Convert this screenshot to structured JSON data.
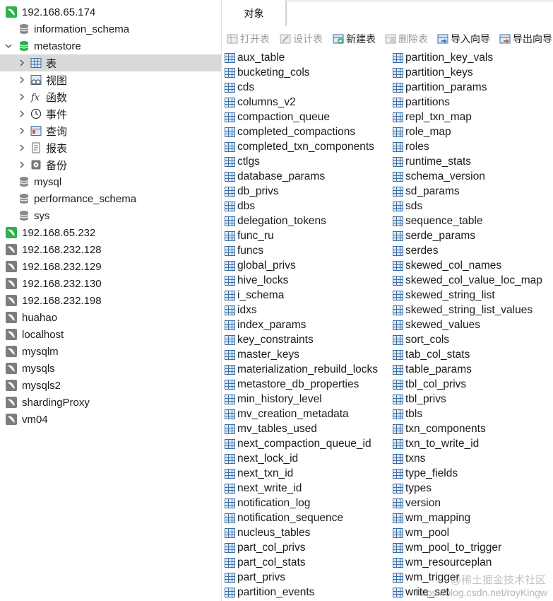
{
  "nav": {
    "items": [
      {
        "label": "192.168.65.174",
        "kind": "connection",
        "state": "open",
        "icon": "connection-green-icon"
      },
      {
        "label": "information_schema",
        "kind": "database",
        "icon": "database-icon"
      },
      {
        "label": "metastore",
        "kind": "database",
        "state": "open",
        "icon": "database-green-icon"
      },
      {
        "label": "表",
        "kind": "group",
        "selected": true,
        "icon": "table-grid-icon"
      },
      {
        "label": "视图",
        "kind": "group",
        "icon": "view-icon"
      },
      {
        "label": "函数",
        "kind": "group",
        "icon": "function-icon"
      },
      {
        "label": "事件",
        "kind": "group",
        "icon": "clock-icon"
      },
      {
        "label": "查询",
        "kind": "group",
        "icon": "query-icon"
      },
      {
        "label": "报表",
        "kind": "group",
        "icon": "report-icon"
      },
      {
        "label": "备份",
        "kind": "group",
        "icon": "backup-icon"
      },
      {
        "label": "mysql",
        "kind": "database",
        "icon": "database-icon"
      },
      {
        "label": "performance_schema",
        "kind": "database",
        "icon": "database-icon"
      },
      {
        "label": "sys",
        "kind": "database",
        "icon": "database-icon"
      },
      {
        "label": "192.168.65.232",
        "kind": "connection",
        "icon": "connection-green-icon"
      },
      {
        "label": "192.168.232.128",
        "kind": "connection",
        "icon": "connection-gray-icon"
      },
      {
        "label": "192.168.232.129",
        "kind": "connection",
        "icon": "connection-gray-icon"
      },
      {
        "label": "192.168.232.130",
        "kind": "connection",
        "icon": "connection-gray-icon"
      },
      {
        "label": "192.168.232.198",
        "kind": "connection",
        "icon": "connection-gray-icon"
      },
      {
        "label": "huahao",
        "kind": "connection",
        "icon": "connection-gray-icon"
      },
      {
        "label": "localhost",
        "kind": "connection",
        "icon": "connection-gray-icon"
      },
      {
        "label": "mysqlm",
        "kind": "connection",
        "icon": "connection-gray-icon"
      },
      {
        "label": "mysqls",
        "kind": "connection",
        "icon": "connection-gray-icon"
      },
      {
        "label": "mysqls2",
        "kind": "connection",
        "icon": "connection-gray-icon"
      },
      {
        "label": "shardingProxy",
        "kind": "connection",
        "icon": "connection-gray-icon"
      },
      {
        "label": "vm04",
        "kind": "connection",
        "icon": "connection-gray-icon"
      }
    ]
  },
  "tabs": {
    "objects_label": "对象"
  },
  "toolbar": {
    "open_table": "打开表",
    "design_table": "设计表",
    "new_table": "新建表",
    "delete_table": "删除表",
    "import_wizard": "导入向导",
    "export_wizard": "导出向导"
  },
  "tables": {
    "col1": [
      "aux_table",
      "bucketing_cols",
      "cds",
      "columns_v2",
      "compaction_queue",
      "completed_compactions",
      "completed_txn_components",
      "ctlgs",
      "database_params",
      "db_privs",
      "dbs",
      "delegation_tokens",
      "func_ru",
      "funcs",
      "global_privs",
      "hive_locks",
      "i_schema",
      "idxs",
      "index_params",
      "key_constraints",
      "master_keys",
      "materialization_rebuild_locks",
      "metastore_db_properties",
      "min_history_level",
      "mv_creation_metadata",
      "mv_tables_used",
      "next_compaction_queue_id",
      "next_lock_id",
      "next_txn_id",
      "next_write_id",
      "notification_log",
      "notification_sequence",
      "nucleus_tables",
      "part_col_privs",
      "part_col_stats",
      "part_privs",
      "partition_events"
    ],
    "col2": [
      "partition_key_vals",
      "partition_keys",
      "partition_params",
      "partitions",
      "repl_txn_map",
      "role_map",
      "roles",
      "runtime_stats",
      "schema_version",
      "sd_params",
      "sds",
      "sequence_table",
      "serde_params",
      "serdes",
      "skewed_col_names",
      "skewed_col_value_loc_map",
      "skewed_string_list",
      "skewed_string_list_values",
      "skewed_values",
      "sort_cols",
      "tab_col_stats",
      "table_params",
      "tbl_col_privs",
      "tbl_privs",
      "tbls",
      "txn_components",
      "txn_to_write_id",
      "txns",
      "type_fields",
      "types",
      "version",
      "wm_mapping",
      "wm_pool",
      "wm_pool_to_trigger",
      "wm_resourceplan",
      "wm_trigger",
      "write_set"
    ]
  },
  "watermark": {
    "line1": "@稀土掘金技术社区",
    "line2": "https://blog.csdn.net/royKingw"
  },
  "colors": {
    "accent": "#2bb24c",
    "selected_row": "#d9d9d9",
    "icon_blue": "#3a6ea5"
  }
}
